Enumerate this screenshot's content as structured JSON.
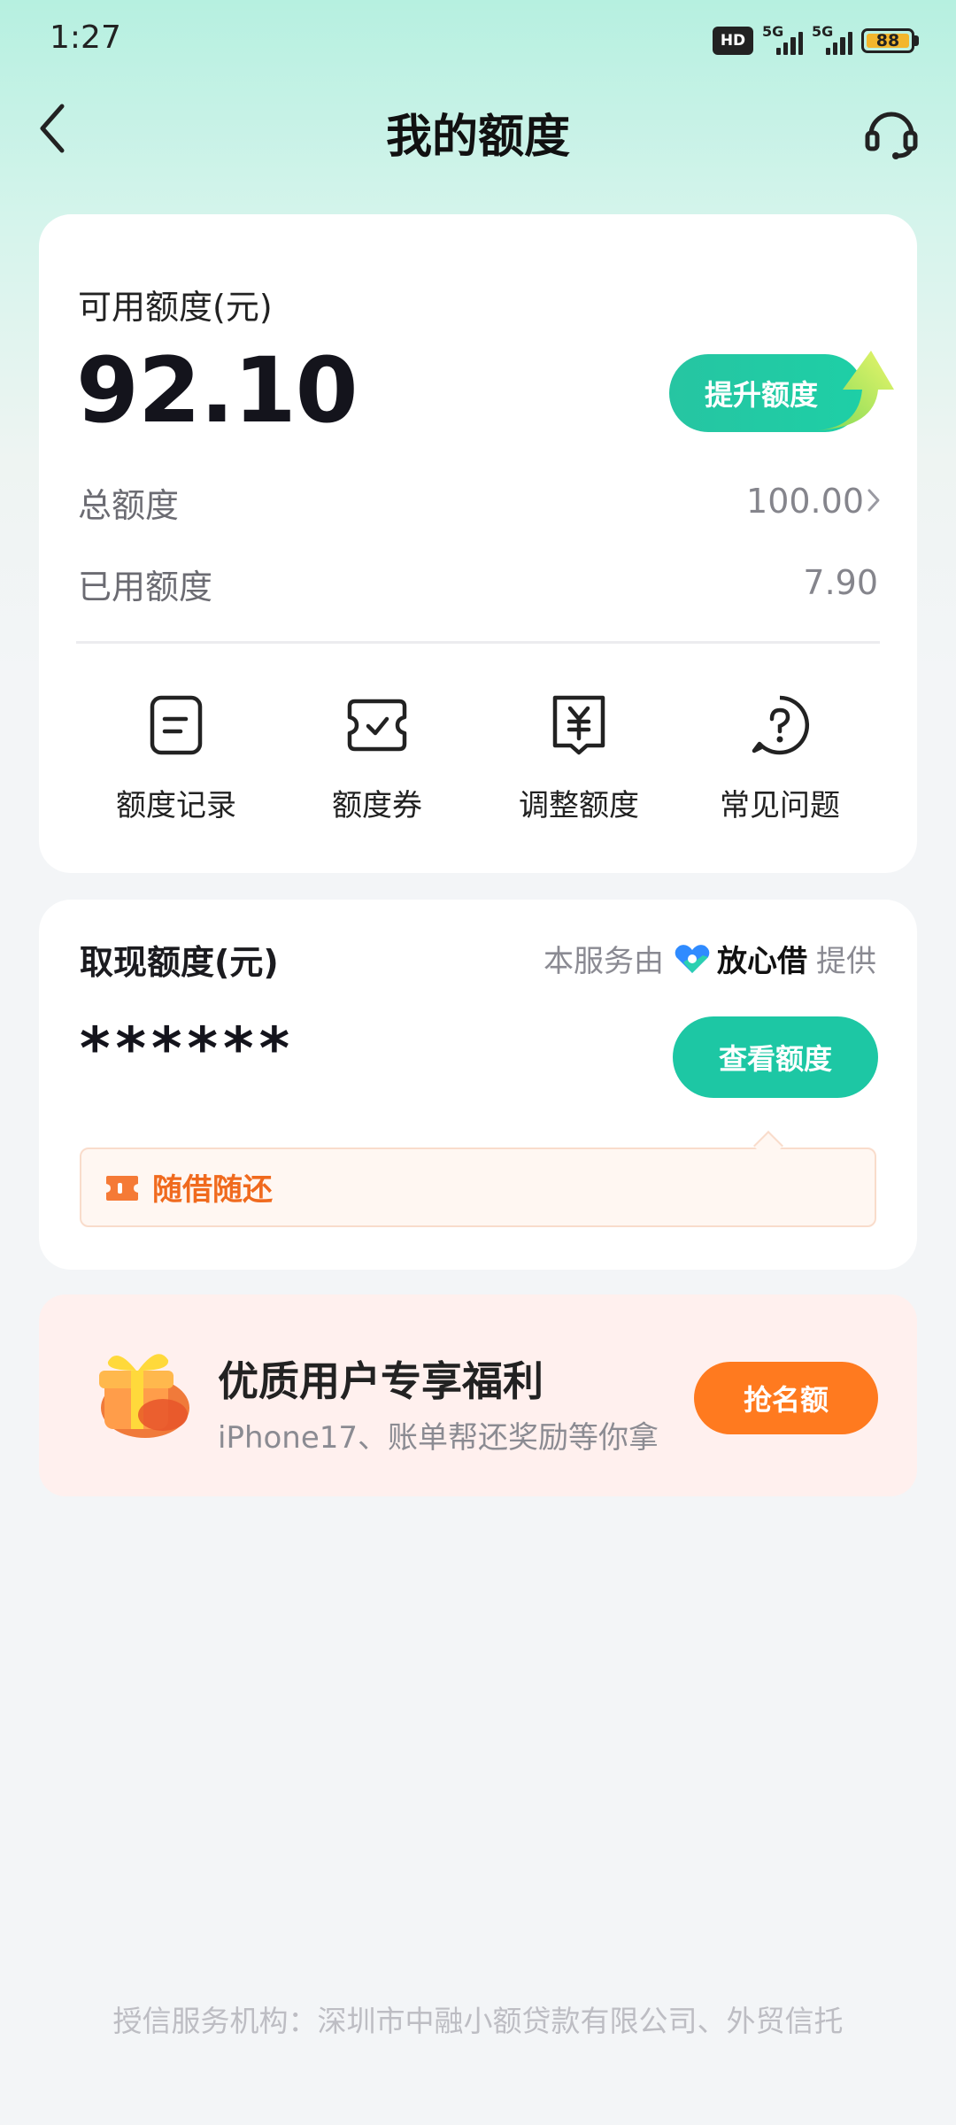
{
  "status_bar": {
    "time": "1:27",
    "hd_label": "HD",
    "net1": "5G",
    "net2": "5G",
    "battery": "88"
  },
  "header": {
    "title": "我的额度",
    "back_icon": "chevron-left-icon",
    "support_icon": "headset-icon"
  },
  "credit_card": {
    "available_label": "可用额度(元)",
    "available_value": "92.10",
    "upgrade_button": "提升额度",
    "total_label": "总额度",
    "total_value": "100.00",
    "used_label": "已用额度",
    "used_value": "7.90",
    "quick_actions": [
      {
        "label": "额度记录",
        "icon": "record-icon"
      },
      {
        "label": "额度券",
        "icon": "coupon-icon"
      },
      {
        "label": "调整额度",
        "icon": "yuan-adjust-icon"
      },
      {
        "label": "常见问题",
        "icon": "question-icon"
      }
    ]
  },
  "cash_card": {
    "title": "取现额度(元)",
    "provided_prefix": "本服务由",
    "provider": "放心借",
    "provided_suffix": "提供",
    "masked_value": "******",
    "view_button": "查看额度",
    "tip_text": "随借随还"
  },
  "promo": {
    "title": "优质用户专享福利",
    "subtitle": "iPhone17、账单帮还奖励等你拿",
    "button": "抢名额"
  },
  "footer": {
    "text": "授信服务机构：深圳市中融小额贷款有限公司、外贸信托"
  },
  "colors": {
    "accent": "#1dc7a4",
    "orange": "#ff7a1f",
    "header_bg": "#b6f0e0"
  }
}
